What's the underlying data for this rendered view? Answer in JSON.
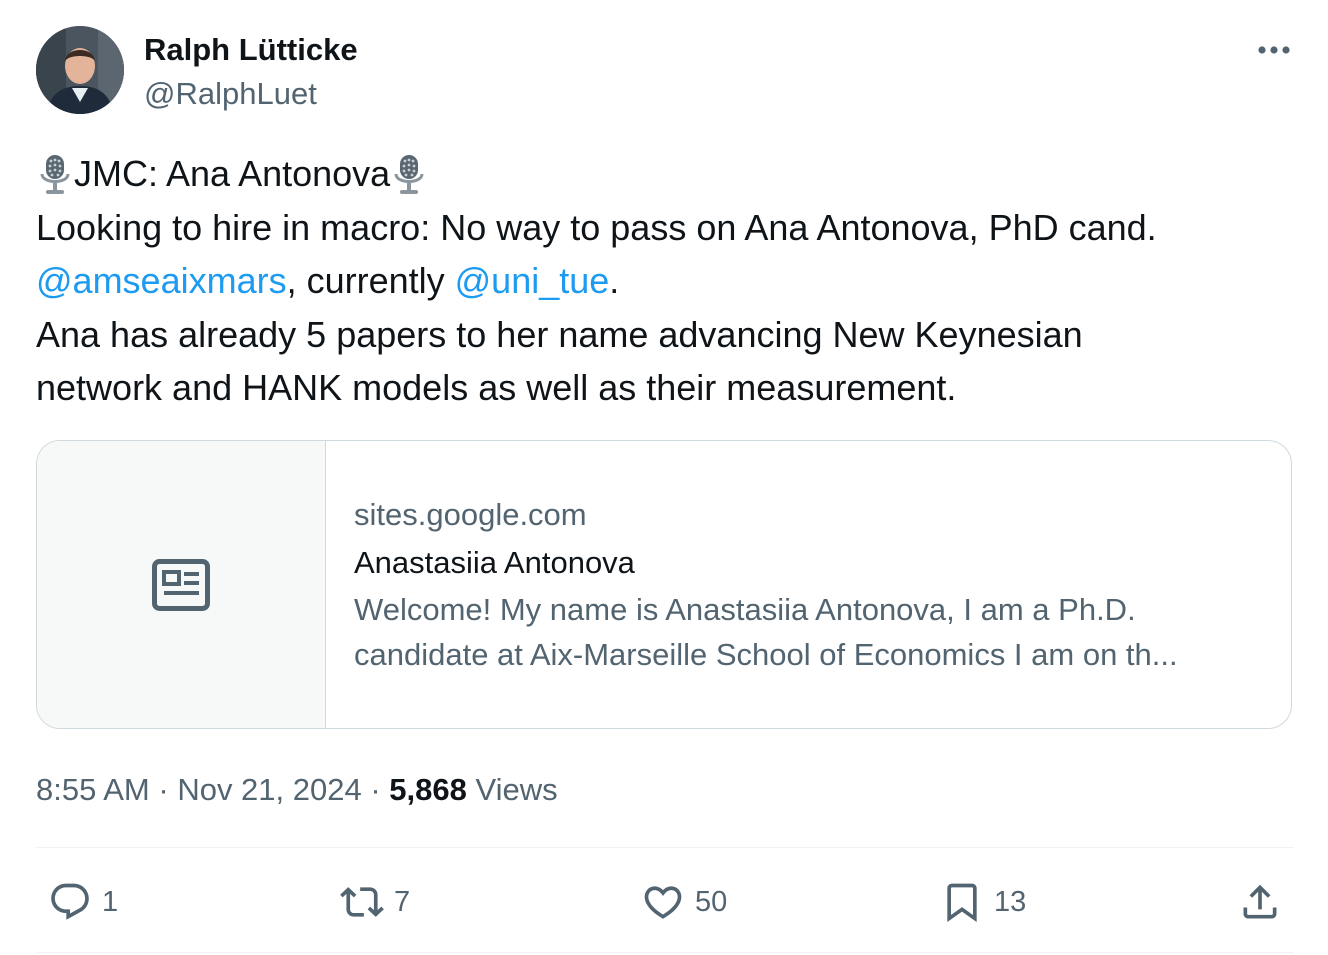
{
  "author": {
    "name": "Ralph Lütticke",
    "handle": "@RalphLuet"
  },
  "tweet": {
    "line1_text": "JMC: Ana Antonova",
    "line2": "Looking to hire in macro: No way to pass on Ana Antonova, PhD cand.",
    "mention1": "@amseaixmars",
    "line3_mid": ", currently ",
    "mention2": "@uni_tue",
    "line3_end": ".",
    "line4": "Ana has already 5 papers to her name advancing New Keynesian",
    "line5": "network and HANK models as well as their measurement."
  },
  "card": {
    "domain": "sites.google.com",
    "title": "Anastasiia Antonova",
    "description": "Welcome! My name is Anastasiia Antonova, I am a Ph.D. candidate at Aix-Marseille School of Economics I am on th...",
    "thumb_icon": "article-icon"
  },
  "meta": {
    "time": "8:55 AM",
    "separator": " · ",
    "date": "Nov 21, 2024",
    "views_count": "5,868",
    "views_label": " Views"
  },
  "actions": {
    "replies": "1",
    "reposts": "7",
    "likes": "50",
    "bookmarks": "13"
  },
  "colors": {
    "text": "#0f1419",
    "secondary": "#536471",
    "link": "#1d9bf0",
    "border": "#cfd9de"
  }
}
